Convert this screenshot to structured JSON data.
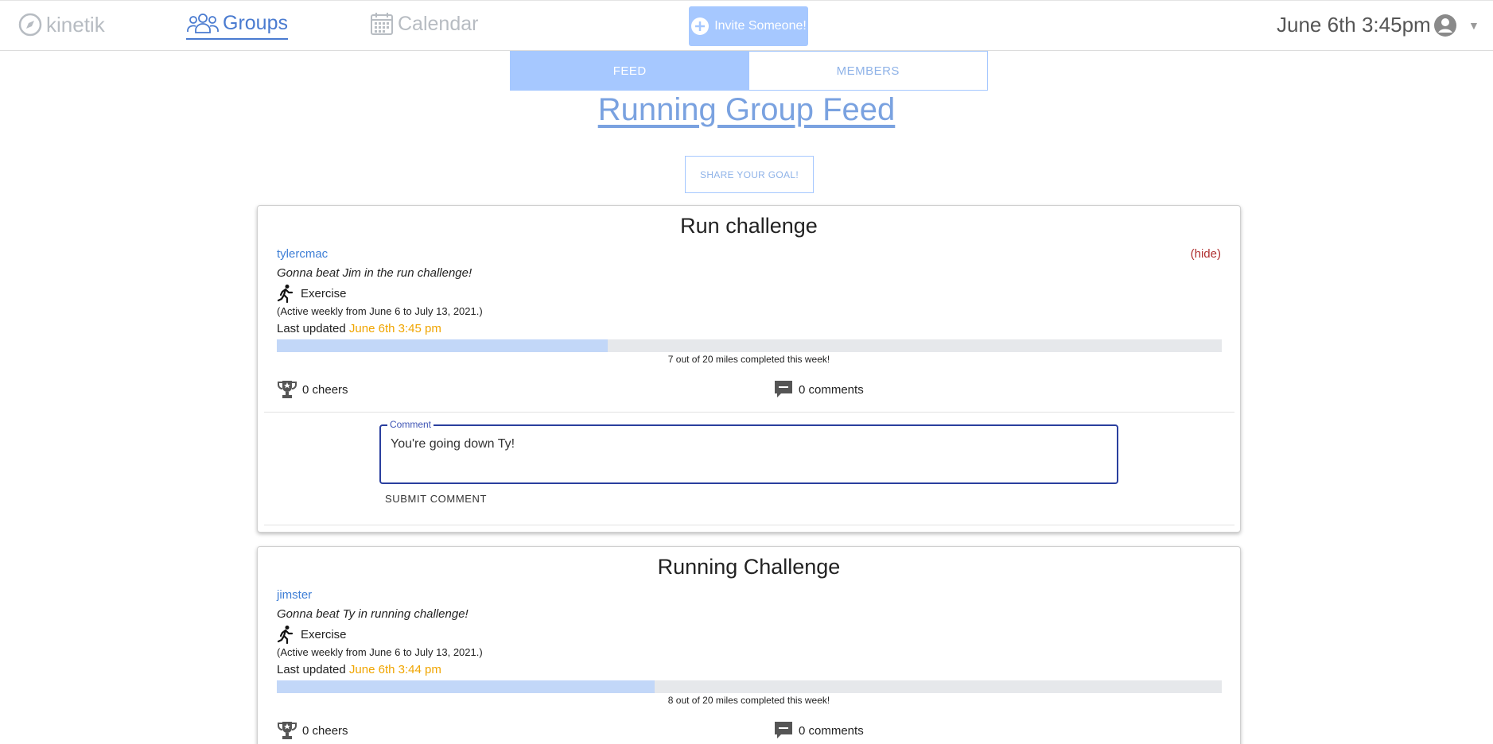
{
  "nav": {
    "logo": "kinetik",
    "groups": "Groups",
    "calendar": "Calendar",
    "invite": "Invite Someone!",
    "datetime": "June 6th 3:45pm"
  },
  "tabs": {
    "feed": "FEED",
    "members": "MEMBERS"
  },
  "page": {
    "title": "Running Group Feed",
    "share_button": "SHARE YOUR GOAL!"
  },
  "posts": [
    {
      "title": "Run challenge",
      "username": "tylercmac",
      "hide": "(hide)",
      "description": "Gonna beat Jim in the run challenge!",
      "category": "Exercise",
      "active_range": "(Active weekly from June 6 to July 13, 2021.)",
      "last_updated_label": "Last updated",
      "last_updated": "June 6th 3:45 pm",
      "progress_fraction": 0.35,
      "progress_text": "7 out of 20 miles completed this week!",
      "cheers": "0 cheers",
      "comments": "0 comments",
      "comment_legend": "Comment",
      "comment_value": "You're going down Ty!",
      "submit_comment": "SUBMIT COMMENT"
    },
    {
      "title": "Running Challenge",
      "username": "jimster",
      "description": "Gonna beat Ty in running challenge!",
      "category": "Exercise",
      "active_range": "(Active weekly from June 6 to July 13, 2021.)",
      "last_updated_label": "Last updated",
      "last_updated": "June 6th 3:44 pm",
      "progress_fraction": 0.4,
      "progress_text": "8 out of 20 miles completed this week!",
      "cheers": "0 cheers",
      "comments": "0 comments"
    }
  ],
  "colors": {
    "accent": "#a6c8ff",
    "link": "#3f7fd6",
    "timestamp": "#f0a500",
    "hide": "#b03030"
  }
}
